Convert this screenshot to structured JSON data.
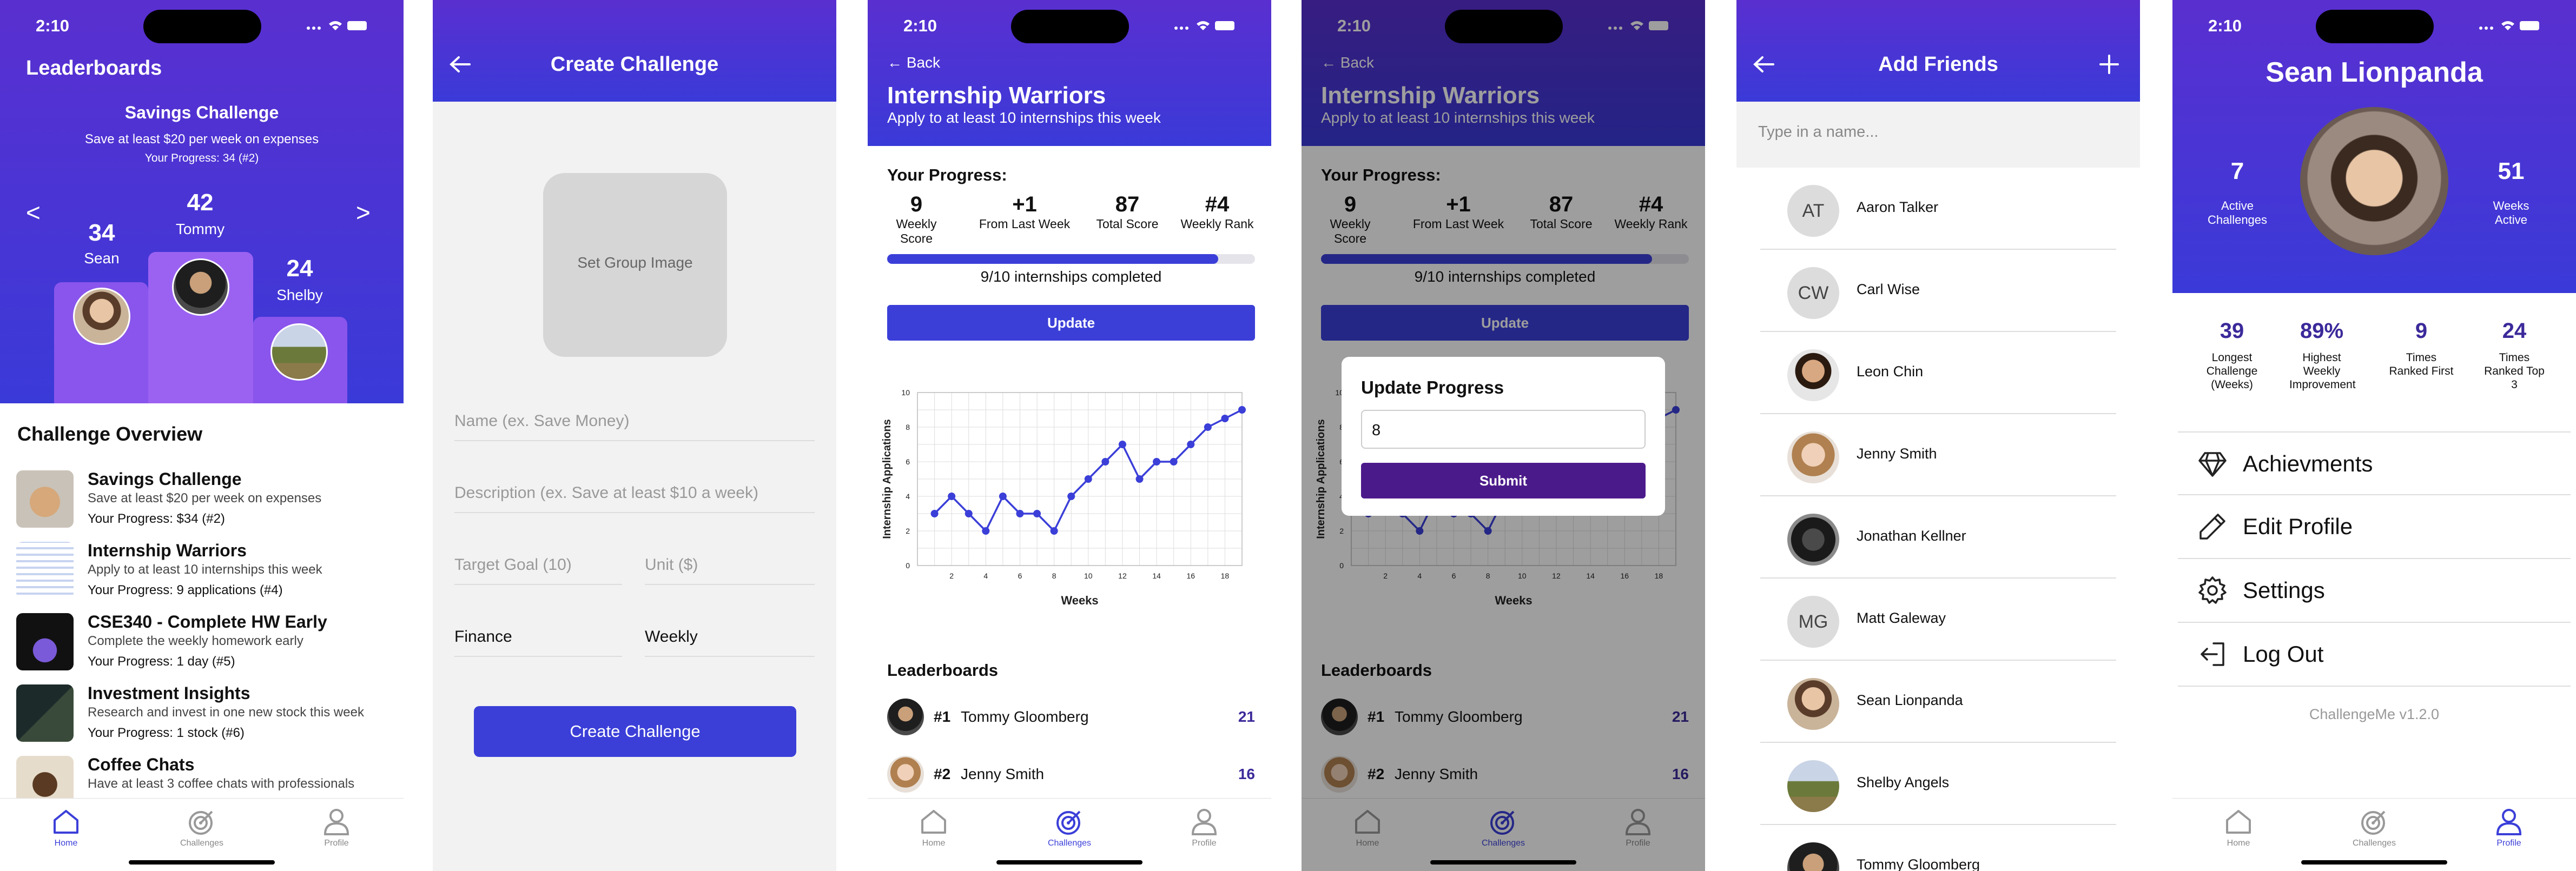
{
  "status_time": "2:10",
  "tabs": {
    "home": "Home",
    "challenges": "Challenges",
    "profile": "Profile"
  },
  "screen1": {
    "title": "Leaderboards",
    "challenge_title": "Savings Challenge",
    "challenge_desc": "Save at least $20 per week on expenses",
    "progress": "Your Progress: 34 (#2)",
    "prev": "<",
    "next": ">",
    "podium": [
      {
        "score": "34",
        "name": "Sean"
      },
      {
        "score": "42",
        "name": "Tommy"
      },
      {
        "score": "24",
        "name": "Shelby"
      }
    ],
    "overview_title": "Challenge Overview",
    "challenges": [
      {
        "title": "Savings Challenge",
        "desc": "Save at least $20 per week on expenses",
        "progress": "Your Progress: $34 (#2)"
      },
      {
        "title": "Internship Warriors",
        "desc": "Apply to at least 10 internships this week",
        "progress": "Your Progress: 9 applications (#4)"
      },
      {
        "title": "CSE340 - Complete HW Early",
        "desc": "Complete the weekly homework early",
        "progress": "Your Progress: 1 day (#5)"
      },
      {
        "title": "Investment Insights",
        "desc": "Research and invest in one new stock this week",
        "progress": "Your Progress: 1 stock (#6)"
      },
      {
        "title": "Coffee Chats",
        "desc": "Have at least 3 coffee chats with professionals",
        "progress": ""
      }
    ]
  },
  "screen2": {
    "title": "Create Challenge",
    "image_label": "Set Group Image",
    "name_ph": "Name (ex. Save Money)",
    "desc_ph": "Description (ex. Save at least $10 a week)",
    "target_ph": "Target Goal (10)",
    "unit_ph": "Unit ($)",
    "category": "Finance",
    "frequency": "Weekly",
    "create_btn": "Create Challenge"
  },
  "screen3": {
    "back": "Back",
    "title": "Internship Warriors",
    "subtitle": "Apply to at least 10 internships this week",
    "progress_title": "Your Progress:",
    "stats": [
      {
        "value": "9",
        "label": "Weekly Score"
      },
      {
        "value": "+1",
        "label": "From Last Week"
      },
      {
        "value": "87",
        "label": "Total Score"
      },
      {
        "value": "#4",
        "label": "Weekly Rank"
      }
    ],
    "progress_fraction": 0.9,
    "progress_text": "9/10 internships completed",
    "update_btn": "Update",
    "leaderboards_title": "Leaderboards",
    "leaders": [
      {
        "rank": "#1",
        "name": "Tommy Gloomberg",
        "score": "21"
      },
      {
        "rank": "#2",
        "name": "Jenny Smith",
        "score": "16"
      }
    ]
  },
  "screen4": {
    "modal_title": "Update Progress",
    "input_value": "8",
    "submit_btn": "Submit"
  },
  "chart_data": {
    "type": "line",
    "xlabel": "Weeks",
    "ylabel": "Internship Applications",
    "xlim": [
      0,
      19
    ],
    "ylim": [
      0,
      10
    ],
    "xticks": [
      2,
      4,
      6,
      8,
      10,
      12,
      14,
      16,
      18
    ],
    "yticks": [
      0,
      2,
      4,
      6,
      8,
      10
    ],
    "grid": true,
    "x": [
      1,
      2,
      3,
      4,
      5,
      6,
      7,
      8,
      9,
      10,
      11,
      12,
      13,
      14,
      15,
      16,
      17,
      18,
      19
    ],
    "y": [
      3,
      4,
      3,
      2,
      4,
      3,
      3,
      2,
      4,
      5,
      6,
      7,
      5,
      6,
      6,
      7,
      8,
      8.5,
      9
    ],
    "color": "#3b3fd8"
  },
  "screen5": {
    "title": "Add Friends",
    "search_ph": "Type in a name...",
    "friends": [
      {
        "initials": "AT",
        "name": "Aaron Talker"
      },
      {
        "initials": "CW",
        "name": "Carl Wise"
      },
      {
        "initials": "",
        "name": "Leon Chin"
      },
      {
        "initials": "",
        "name": "Jenny Smith"
      },
      {
        "initials": "",
        "name": "Jonathan Kellner"
      },
      {
        "initials": "MG",
        "name": "Matt Galeway"
      },
      {
        "initials": "",
        "name": "Sean Lionpanda"
      },
      {
        "initials": "",
        "name": "Shelby Angels"
      },
      {
        "initials": "",
        "name": "Tommy Gloomberg"
      }
    ]
  },
  "screen6": {
    "name": "Sean Lionpanda",
    "active_value": "7",
    "active_label": "Active Challenges",
    "weeks_value": "51",
    "weeks_label": "Weeks Active",
    "stats": [
      {
        "value": "39",
        "label": "Longest Challenge (Weeks)"
      },
      {
        "value": "89%",
        "label": "Highest Weekly Improvement"
      },
      {
        "value": "9",
        "label": "Times Ranked First"
      },
      {
        "value": "24",
        "label": "Times Ranked Top 3"
      }
    ],
    "menu": [
      "Achievments",
      "Edit Profile",
      "Settings",
      "Log Out"
    ],
    "version": "ChallengeMe v1.2.0"
  },
  "colors": {
    "primary": "#3b3fd8",
    "header_top": "#5a2fd0",
    "submit": "#4b1a8a",
    "score": "#3b2a9a"
  }
}
